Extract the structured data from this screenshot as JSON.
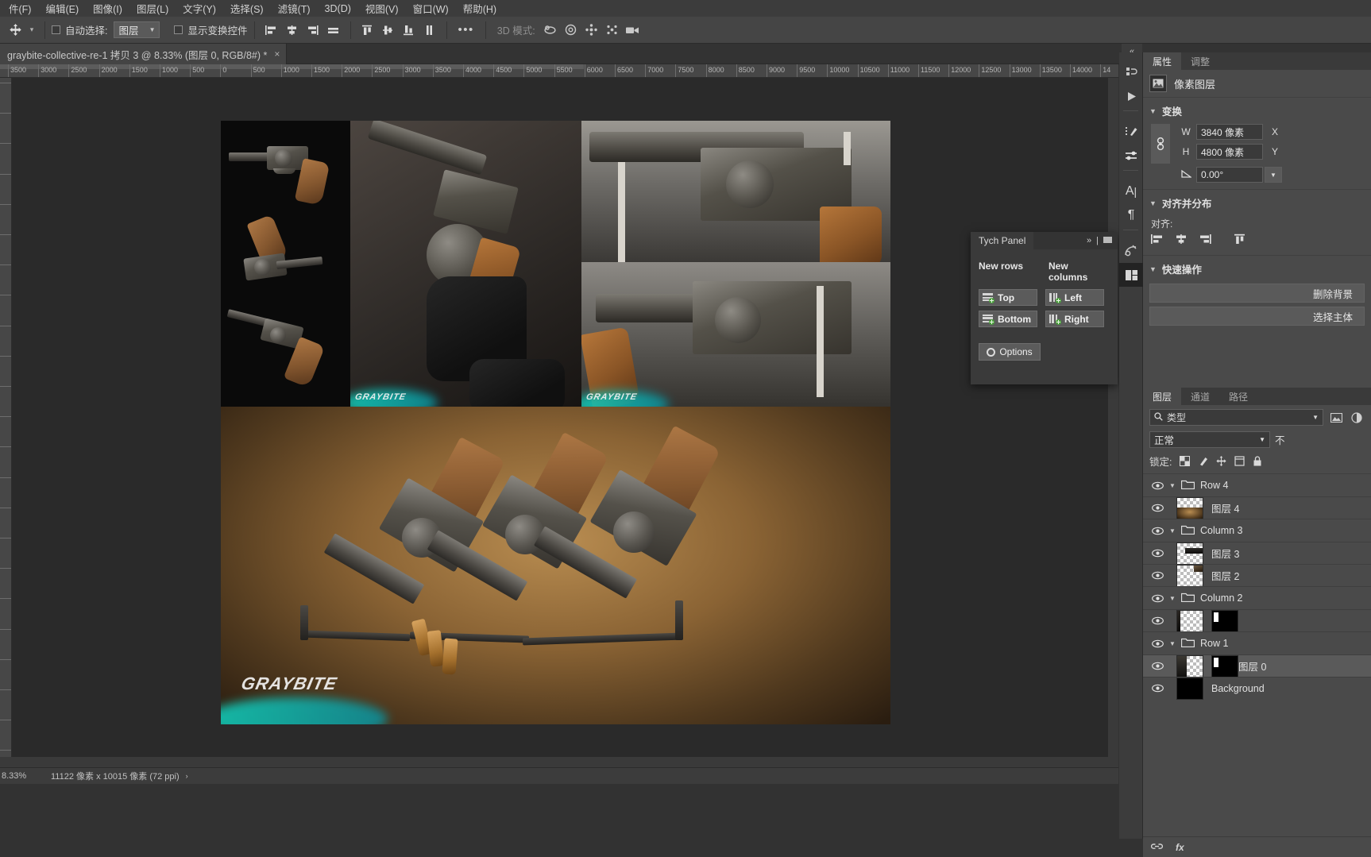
{
  "app": {
    "menu": [
      {
        "label": "件(F)"
      },
      {
        "label": "编辑(E)"
      },
      {
        "label": "图像(I)"
      },
      {
        "label": "图层(L)"
      },
      {
        "label": "文字(Y)"
      },
      {
        "label": "选择(S)"
      },
      {
        "label": "滤镜(T)"
      },
      {
        "label": "3D(D)"
      },
      {
        "label": "视图(V)"
      },
      {
        "label": "窗口(W)"
      },
      {
        "label": "帮助(H)"
      }
    ]
  },
  "options_bar": {
    "tool_icon": "move-tool-icon",
    "auto_select_label": "自动选择:",
    "auto_select_value": "图层",
    "show_transform_label": "显示变换控件",
    "more_label": "•••",
    "mode3d_label": "3D 模式:",
    "align_icons": [
      "align-left-edges-icon",
      "align-horizontal-centers-icon",
      "align-right-edges-icon",
      "align-horizontal-distribute-icon",
      "align-top-edges-icon",
      "align-vertical-centers-icon",
      "align-bottom-edges-icon",
      "align-vertical-distribute-icon"
    ],
    "mode3d_icons": [
      "3d-orbit-icon",
      "3d-roll-icon",
      "3d-pan-icon",
      "3d-slide-icon",
      "3d-camera-icon"
    ]
  },
  "document_tab": {
    "title": "graybite-collective-re-1 拷贝 3 @ 8.33% (图层 0, RGB/8#) *",
    "close_label": "×"
  },
  "ruler": {
    "unit": "像素",
    "labels": [
      "3500",
      "3000",
      "2500",
      "2000",
      "1500",
      "1000",
      "500",
      "0",
      "500",
      "1000",
      "1500",
      "2000",
      "2500",
      "3000",
      "3500",
      "4000",
      "4500",
      "5000",
      "5500",
      "6000",
      "6500",
      "7000",
      "7500",
      "8000",
      "8500",
      "9000",
      "9500",
      "10000",
      "10500",
      "11000",
      "11500",
      "12000",
      "12500",
      "13000",
      "13500",
      "14000",
      "14"
    ]
  },
  "status_bar": {
    "zoom": "8.33%",
    "doc_dimensions": "11122 像素 x 10015 像素 (72 ppi)",
    "expand_arrow": "›"
  },
  "icon_rail": {
    "collapse_label": "«",
    "items": [
      {
        "name": "history-icon"
      },
      {
        "name": "play-actions-icon"
      },
      {
        "name": "adjustments-brush-icon"
      },
      {
        "name": "sliders-icon"
      },
      {
        "name": "character-icon"
      },
      {
        "name": "paragraph-icon"
      },
      {
        "name": "paths-select-icon"
      },
      {
        "name": "tych-panel-icon"
      }
    ]
  },
  "properties_panel": {
    "tabs": [
      {
        "label": "属性",
        "active": true
      },
      {
        "label": "调整",
        "active": false
      }
    ],
    "layer_kind": "像素图层",
    "transform": {
      "title": "变换",
      "link_icon": "link-aspect-ratio-icon",
      "w_label": "W",
      "w_value": "3840 像素",
      "x_label": "X",
      "h_label": "H",
      "h_value": "4800 像素",
      "y_label": "Y",
      "angle_icon": "angle-icon",
      "angle_value": "0.00°"
    },
    "align_distribute": {
      "title": "对齐并分布",
      "align_label": "对齐:",
      "icons": [
        "align-left-edges-icon",
        "align-horizontal-centers-icon",
        "align-right-edges-icon",
        "align-top-edges-icon"
      ]
    },
    "quick_actions": {
      "title": "快速操作",
      "buttons": [
        {
          "label": "删除背景"
        },
        {
          "label": "选择主体"
        }
      ]
    }
  },
  "layers_panel": {
    "tabs": [
      {
        "label": "图层",
        "active": true
      },
      {
        "label": "通道",
        "active": false
      },
      {
        "label": "路径",
        "active": false
      }
    ],
    "filter": {
      "search_icon": "search-icon",
      "type_label": "类型",
      "icons": [
        "filter-image-icon",
        "filter-adjustment-icon"
      ]
    },
    "blend_mode": "正常",
    "opacity_label": "不",
    "lock_label": "锁定:",
    "lock_icons": [
      "lock-transparent-pixels-icon",
      "lock-image-pixels-icon",
      "lock-position-icon",
      "lock-artboard-nesting-icon",
      "lock-all-icon"
    ],
    "rows": [
      {
        "name": "Row 4",
        "type": "group",
        "indent": 0,
        "visible": true,
        "expanded": true
      },
      {
        "name": "图层 4",
        "type": "layer",
        "indent": 1,
        "visible": true,
        "thumb": "photo-brown",
        "mask": false
      },
      {
        "name": "Column 3",
        "type": "group",
        "indent": 0,
        "visible": true,
        "expanded": true
      },
      {
        "name": "图层 3",
        "type": "layer",
        "indent": 1,
        "visible": true,
        "thumb": "photo-dark-strip",
        "mask": false
      },
      {
        "name": "图层 2",
        "type": "layer",
        "indent": 1,
        "visible": true,
        "thumb": "photo-corner",
        "mask": false
      },
      {
        "name": "Column 2",
        "type": "group",
        "indent": 0,
        "visible": true,
        "expanded": true
      },
      {
        "name": "",
        "type": "layer",
        "indent": 1,
        "visible": true,
        "thumb": "photo-left-edge",
        "mask": true
      },
      {
        "name": "Row 1",
        "type": "group",
        "indent": 0,
        "visible": true,
        "expanded": true
      },
      {
        "name": "图层 0",
        "type": "layer",
        "indent": 1,
        "visible": true,
        "thumb": "photo-gun",
        "mask": true,
        "selected": true
      },
      {
        "name": "Background",
        "type": "layer",
        "indent": 0,
        "visible": true,
        "thumb": "solid-black",
        "mask": false
      }
    ],
    "bottom_icons": [
      "link-layers-icon",
      "layer-style-fx-icon"
    ]
  },
  "tych_panel": {
    "tab_label": "Tych Panel",
    "collapse_icon": "»",
    "menu_icon": "panel-menu-icon",
    "new_rows_label": "New rows",
    "new_columns_label": "New columns",
    "buttons": [
      {
        "label": "Top",
        "icon": "add-row-top-icon"
      },
      {
        "label": "Bottom",
        "icon": "add-row-bottom-icon"
      },
      {
        "label": "Left",
        "icon": "add-column-left-icon"
      },
      {
        "label": "Right",
        "icon": "add-column-right-icon"
      }
    ],
    "options_label": "Options",
    "options_icon": "gear-icon"
  },
  "canvas": {
    "watermark_text": "GRAYBITE",
    "artwork_description": "revolver-photo-collage"
  },
  "colors": {
    "menu_bg": "#3c3c3c",
    "options_bg": "#454545",
    "panel_bg": "#4a4a4a",
    "canvas_bg": "#2a2a2a",
    "accent_green": "#4aa03c",
    "text": "#cfcfcf"
  }
}
